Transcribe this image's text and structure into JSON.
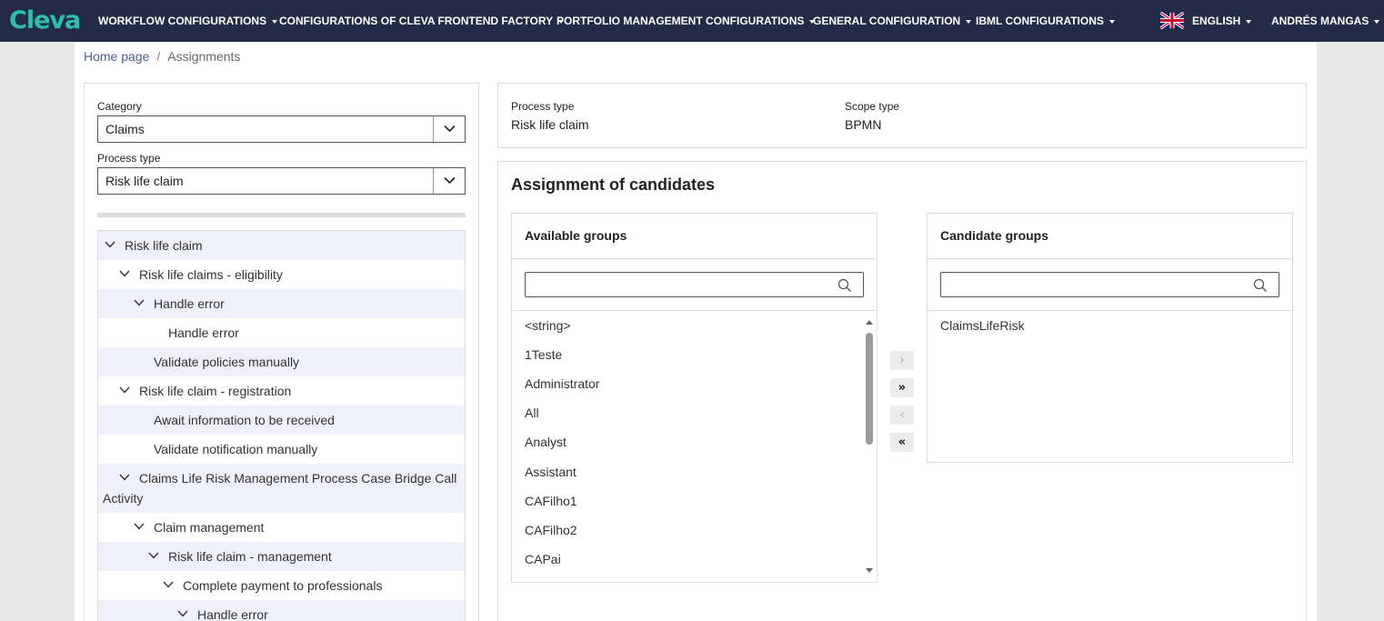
{
  "navbar": {
    "logo": "Cleva",
    "menu": [
      {
        "label": "WORKFLOW CONFIGURATIONS"
      },
      {
        "label": "CONFIGURATIONS OF CLEVA FRONTEND FACTORY"
      },
      {
        "label": "PORTFOLIO MANAGEMENT CONFIGURATIONS"
      },
      {
        "label": "GENERAL CONFIGURATION"
      },
      {
        "label": "IBML CONFIGURATIONS"
      }
    ],
    "language": "ENGLISH",
    "user": "ANDRÉS MANGAS"
  },
  "breadcrumb": {
    "home": "Home page",
    "separator": "/",
    "current": "Assignments"
  },
  "filters": {
    "category_label": "Category",
    "category_value": "Claims",
    "process_type_label": "Process type",
    "process_type_value": "Risk life claim"
  },
  "tree": [
    {
      "label": "Risk life claim",
      "expanded": true
    },
    {
      "label": "Risk life claims - eligibility",
      "expanded": true
    },
    {
      "label": "Handle error",
      "expanded": true
    },
    {
      "label": "Handle error"
    },
    {
      "label": "Validate policies manually"
    },
    {
      "label": "Risk life claim - registration",
      "expanded": true
    },
    {
      "label": "Await information to be received"
    },
    {
      "label": "Validate notification manually"
    },
    {
      "label": "Claims Life Risk Management Process Case Bridge Call Activity",
      "expanded": true
    },
    {
      "label": "Claim management",
      "expanded": true
    },
    {
      "label": "Risk life claim - management",
      "expanded": true
    },
    {
      "label": "Complete payment to professionals",
      "expanded": true
    },
    {
      "label": "Handle error",
      "expanded": true
    }
  ],
  "info": {
    "process_type_label": "Process type",
    "process_type_value": "Risk life claim",
    "scope_type_label": "Scope type",
    "scope_type_value": "BPMN"
  },
  "assignment": {
    "title": "Assignment of candidates",
    "available_title": "Available groups",
    "candidate_title": "Candidate groups",
    "available_groups": [
      "<string>",
      "1Teste",
      "Administrator",
      "All",
      "Analyst",
      "Assistant",
      "CAFilho1",
      "CAFilho2",
      "CAPai"
    ],
    "candidate_groups": [
      "ClaimsLifeRisk"
    ],
    "buttons": {
      "move_right": "›",
      "move_all_right": "»",
      "move_left": "‹",
      "move_all_left": "«"
    }
  },
  "colors": {
    "navbar_bg": "#232c46",
    "logo": "#2cc0a8",
    "tree_alt_row": "#f0f0fa"
  }
}
